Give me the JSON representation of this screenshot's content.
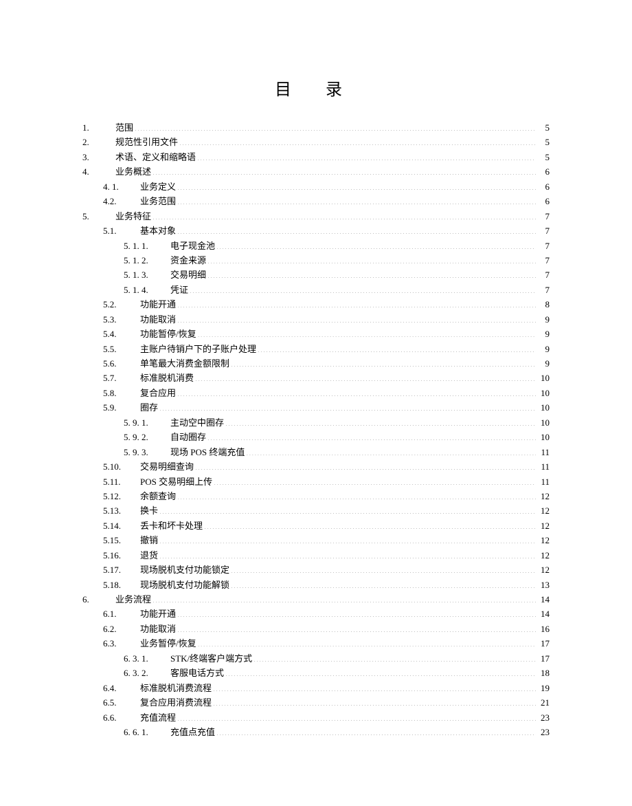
{
  "title": "目 录",
  "entries": [
    {
      "level": 1,
      "num": "1.",
      "label": "范围",
      "page": "5"
    },
    {
      "level": 1,
      "num": "2.",
      "label": "规范性引用文件",
      "page": "5"
    },
    {
      "level": 1,
      "num": "3.",
      "label": "术语、定义和缩略语",
      "page": "5"
    },
    {
      "level": 1,
      "num": "4.",
      "label": "业务概述",
      "page": "6"
    },
    {
      "level": 2,
      "num": "4. 1.",
      "label": "业务定义",
      "page": "6"
    },
    {
      "level": 2,
      "num": "4.2.",
      "label": "业务范围",
      "page": "6"
    },
    {
      "level": 1,
      "num": "5.",
      "label": "业务特征",
      "page": "7"
    },
    {
      "level": 2,
      "num": "5.1.",
      "label": "基本对象",
      "page": "7"
    },
    {
      "level": 3,
      "num": "5. 1. 1.",
      "label": "电子现金池",
      "page": "7"
    },
    {
      "level": 3,
      "num": "5. 1. 2.",
      "label": "资金来源",
      "page": "7"
    },
    {
      "level": 3,
      "num": "5. 1. 3.",
      "label": "交易明细",
      "page": "7"
    },
    {
      "level": 3,
      "num": "5. 1. 4.",
      "label": "凭证",
      "page": "7"
    },
    {
      "level": 2,
      "num": "5.2.",
      "label": "功能开通",
      "page": "8"
    },
    {
      "level": 2,
      "num": "5.3.",
      "label": "功能取消",
      "page": "9"
    },
    {
      "level": 2,
      "num": "5.4.",
      "label": "功能暂停/恢复",
      "page": "9"
    },
    {
      "level": 2,
      "num": "5.5.",
      "label": "主账户待销户下的子账户处理",
      "page": "9"
    },
    {
      "level": 2,
      "num": "5.6.",
      "label": "单笔最大消费金额限制",
      "page": "9"
    },
    {
      "level": 2,
      "num": "5.7.",
      "label": "标准脱机消费",
      "page": "10"
    },
    {
      "level": 2,
      "num": "5.8.",
      "label": "复合应用",
      "page": "10"
    },
    {
      "level": 2,
      "num": "5.9.",
      "label": "圈存",
      "page": "10"
    },
    {
      "level": 3,
      "num": "5. 9. 1.",
      "label": "主动空中圈存",
      "page": "10"
    },
    {
      "level": 3,
      "num": "5. 9. 2.",
      "label": "自动圈存",
      "page": "10"
    },
    {
      "level": 3,
      "num": "5. 9. 3.",
      "label": "现场 POS 终端充值",
      "page": "11"
    },
    {
      "level": 2,
      "num": "5.10.",
      "label": "交易明细查询",
      "page": "11"
    },
    {
      "level": 2,
      "num": "5.11.",
      "label": "POS 交易明细上传",
      "page": "11"
    },
    {
      "level": 2,
      "num": "5.12.",
      "label": "余额查询",
      "page": "12"
    },
    {
      "level": 2,
      "num": "5.13.",
      "label": "换卡",
      "page": "12"
    },
    {
      "level": 2,
      "num": "5.14.",
      "label": "丢卡和坏卡处理",
      "page": "12"
    },
    {
      "level": 2,
      "num": "5.15.",
      "label": "撤销",
      "page": "12"
    },
    {
      "level": 2,
      "num": "5.16.",
      "label": "退货",
      "page": "12"
    },
    {
      "level": 2,
      "num": "5.17.",
      "label": "现场脱机支付功能锁定",
      "page": "12"
    },
    {
      "level": 2,
      "num": "5.18.",
      "label": "现场脱机支付功能解锁",
      "page": "13"
    },
    {
      "level": 1,
      "num": "6.",
      "label": "业务流程",
      "page": "14"
    },
    {
      "level": 2,
      "num": "6.1.",
      "label": "功能开通",
      "page": "14"
    },
    {
      "level": 2,
      "num": "6.2.",
      "label": "功能取消",
      "page": "16"
    },
    {
      "level": 2,
      "num": "6.3.",
      "label": "业务暂停/恢复",
      "page": "17"
    },
    {
      "level": 3,
      "num": "6. 3. 1.",
      "label": "STK/终端客户端方式",
      "page": "17"
    },
    {
      "level": 3,
      "num": "6. 3. 2.",
      "label": "客服电话方式",
      "page": "18"
    },
    {
      "level": 2,
      "num": "6.4.",
      "label": "标准脱机消费流程",
      "page": "19"
    },
    {
      "level": 2,
      "num": "6.5.",
      "label": "复合应用消费流程",
      "page": "21"
    },
    {
      "level": 2,
      "num": "6.6.",
      "label": "充值流程",
      "page": "23"
    },
    {
      "level": 3,
      "num": "6. 6. 1.",
      "label": "充值点充值",
      "page": "23"
    }
  ]
}
